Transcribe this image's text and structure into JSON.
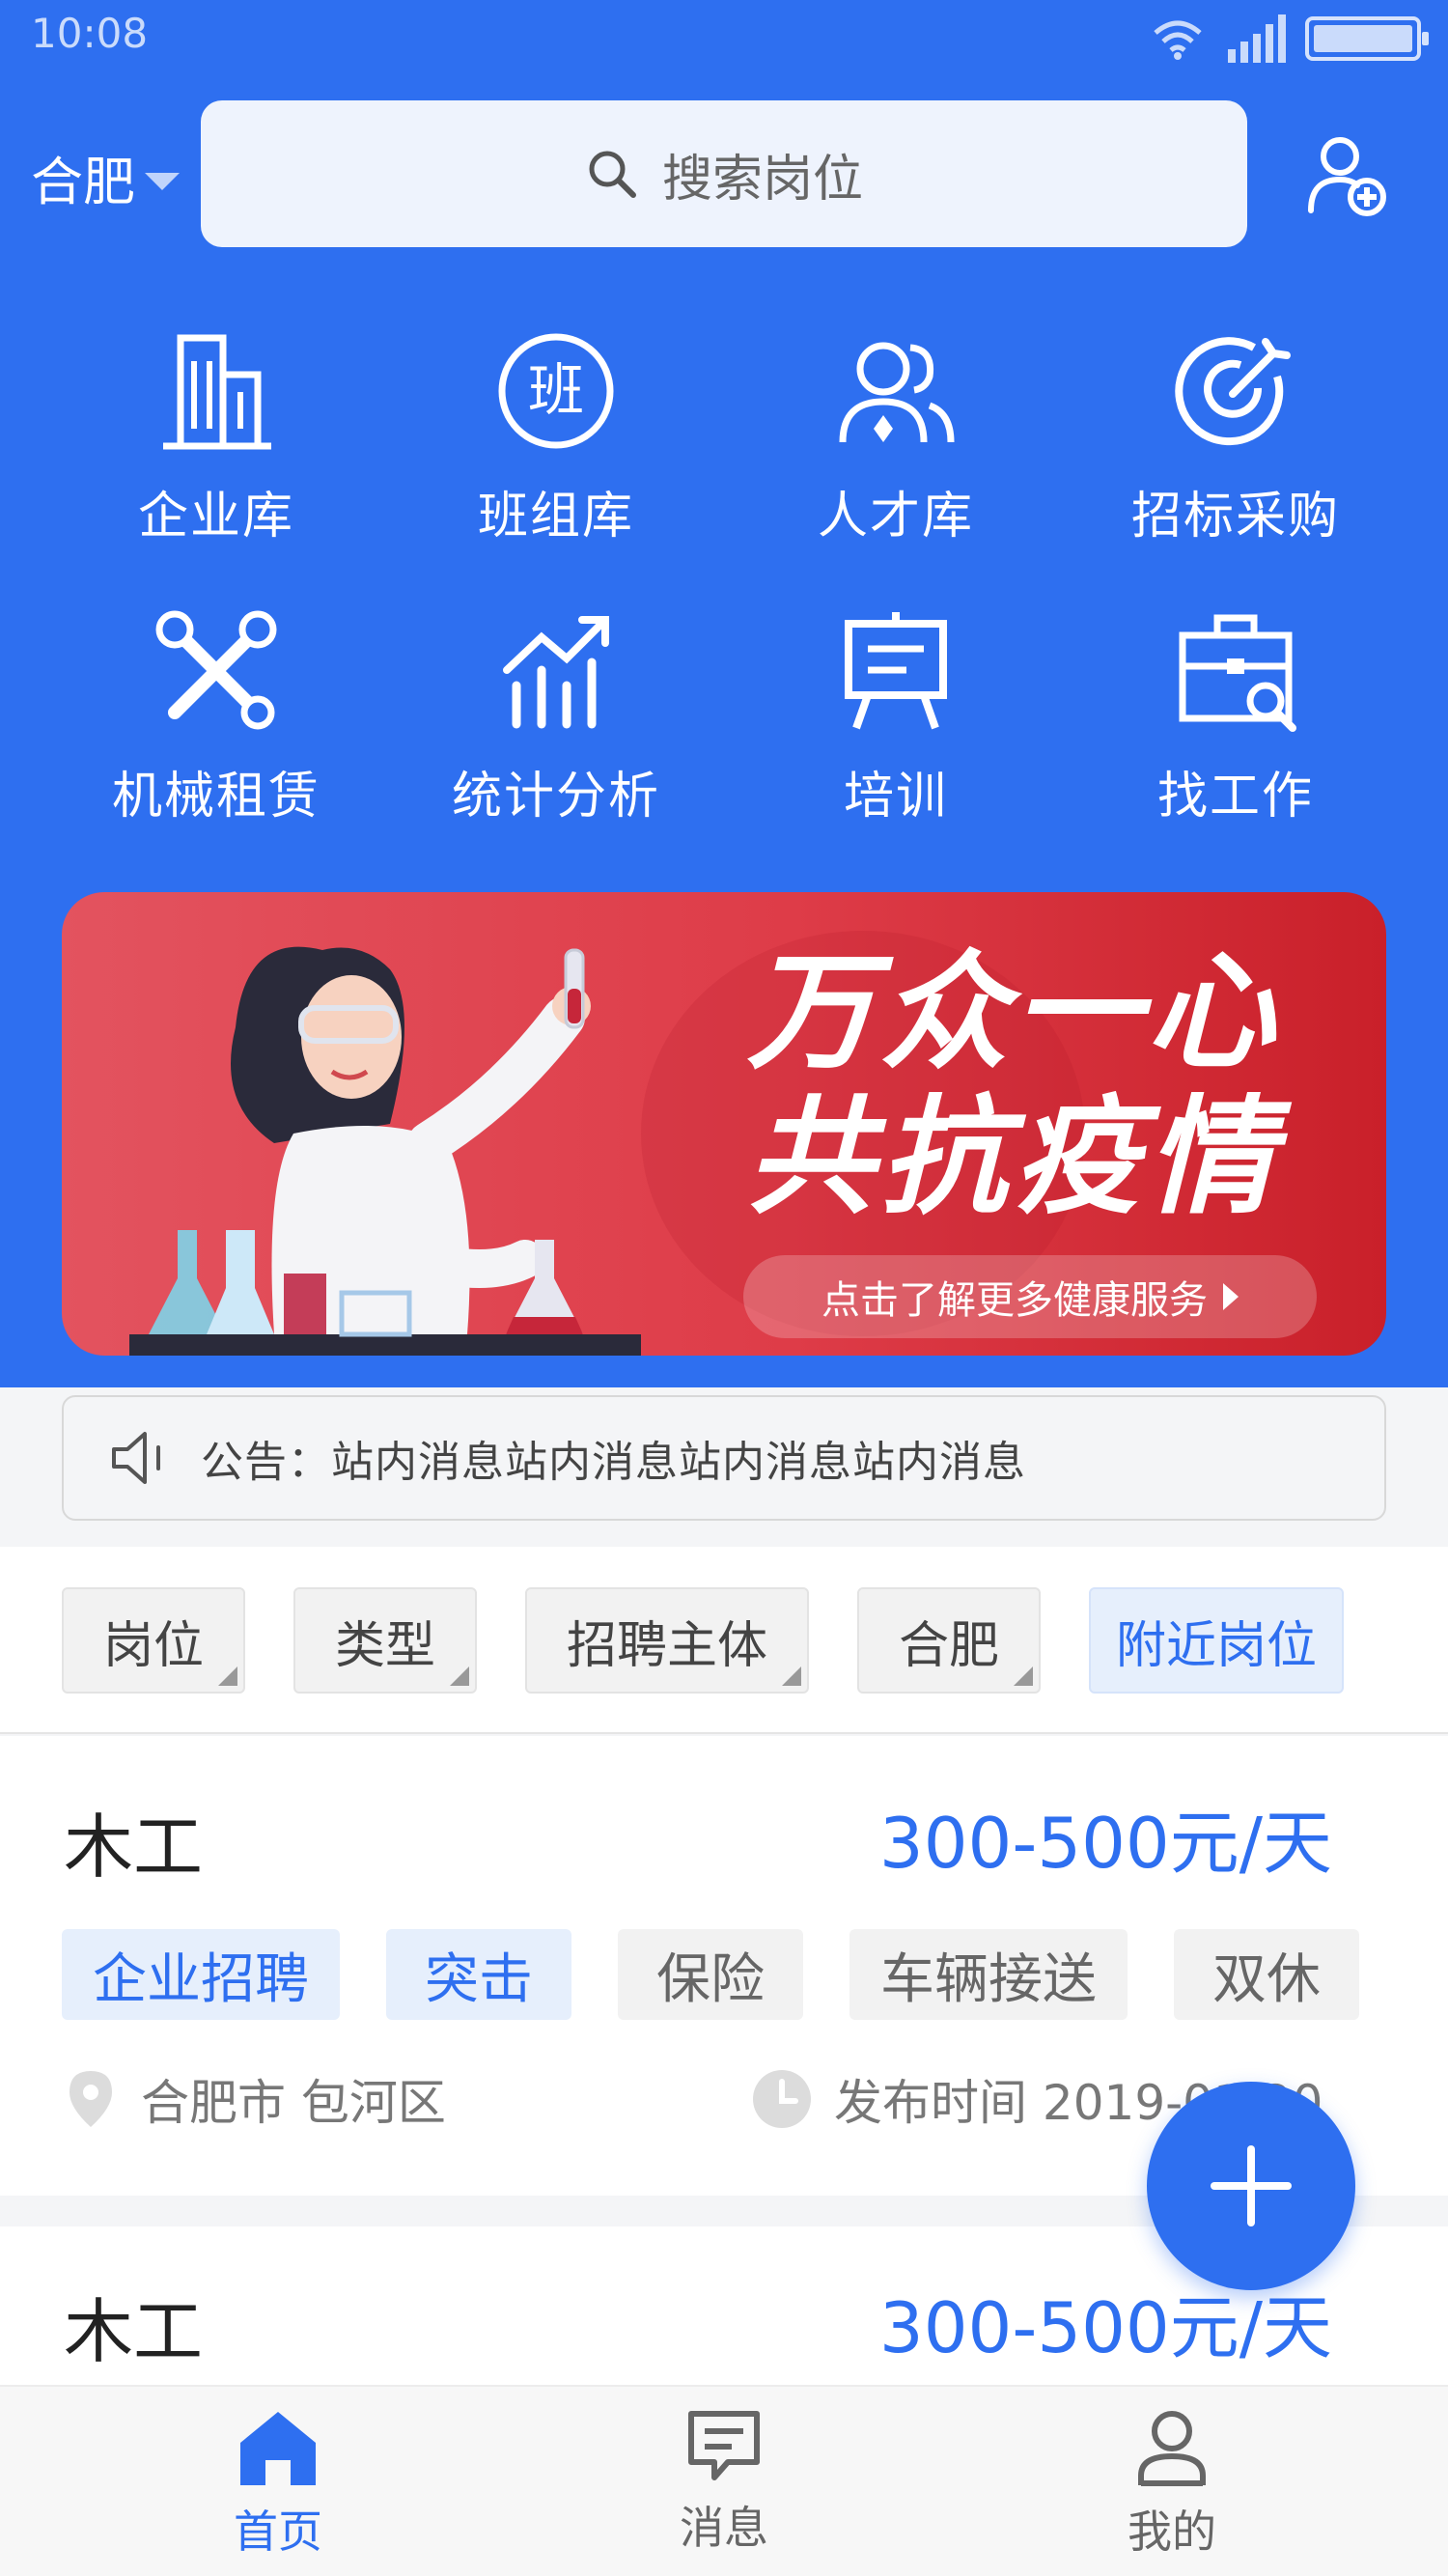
{
  "status_bar": {
    "time": "10:08"
  },
  "header": {
    "city": "合肥",
    "search_placeholder": "搜索岗位"
  },
  "grid": [
    {
      "label": "企业库",
      "icon": "building-icon"
    },
    {
      "label": "班组库",
      "icon": "ban-character-icon",
      "icon_text": "班"
    },
    {
      "label": "人才库",
      "icon": "people-icon"
    },
    {
      "label": "招标采购",
      "icon": "target-icon"
    },
    {
      "label": "机械租赁",
      "icon": "tools-icon"
    },
    {
      "label": "统计分析",
      "icon": "chart-growth-icon"
    },
    {
      "label": "培训",
      "icon": "easel-icon"
    },
    {
      "label": "找工作",
      "icon": "briefcase-search-icon"
    }
  ],
  "banner": {
    "line1": "万众一心",
    "line2": "共抗疫情",
    "cta": "点击了解更多健康服务"
  },
  "notice": {
    "text": "公告：站内消息站内消息站内消息站内消息"
  },
  "filters": [
    {
      "label": "岗位",
      "dropdown": true
    },
    {
      "label": "类型",
      "dropdown": true
    },
    {
      "label": "招聘主体",
      "dropdown": true
    },
    {
      "label": "合肥",
      "dropdown": true
    },
    {
      "label": "附近岗位",
      "dropdown": false,
      "active": true
    }
  ],
  "jobs": [
    {
      "title": "木工",
      "salary": "300-500元/天",
      "tags": [
        "企业招聘",
        "突击",
        "保险",
        "车辆接送",
        "双休"
      ],
      "location": "合肥市 包河区",
      "posted": "发布时间 2019-01-20"
    },
    {
      "title": "木工",
      "salary": "300-500元/天"
    }
  ],
  "bottom_nav": [
    {
      "label": "首页",
      "icon": "home-icon",
      "active": true
    },
    {
      "label": "消息",
      "icon": "message-icon",
      "active": false
    },
    {
      "label": "我的",
      "icon": "profile-icon",
      "active": false
    }
  ],
  "colors": {
    "primary": "#2e6ff0",
    "banner_red": "#de3c48"
  }
}
